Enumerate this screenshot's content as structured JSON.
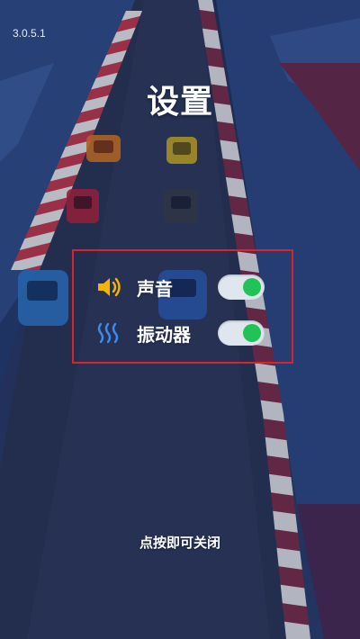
{
  "version": "3.0.5.1",
  "title": "设置",
  "settings": {
    "sound": {
      "label": "声音",
      "icon": "speaker-icon",
      "enabled": true
    },
    "vibration": {
      "label": "振动器",
      "icon": "vibration-icon",
      "enabled": true
    }
  },
  "close_hint": "点按即可关闭",
  "colors": {
    "toggle_on": "#21c256",
    "toggle_track": "#dfe6ee",
    "speaker_icon": "#f5b400",
    "vibration_icon": "#3a8cf0",
    "highlight_border": "#d8242b"
  }
}
